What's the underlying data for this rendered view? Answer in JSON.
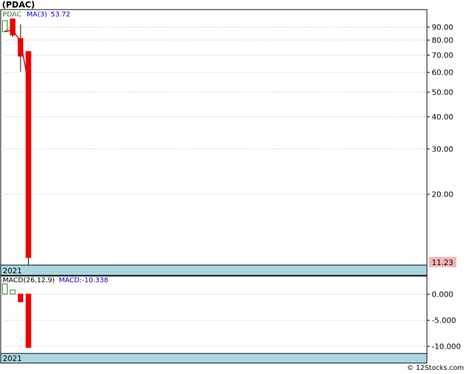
{
  "title": "(PDAC)",
  "footer": "© 12Stocks.com",
  "colors": {
    "up": "#ffffff",
    "up_border": "#2e7d32",
    "down": "#ee0000",
    "ma_line": "#dd0000",
    "ticker_text": "#2e7d32",
    "ma_text": "#0000cc",
    "year_band": "#a9d6e0",
    "last_price_bg": "#f4b6b6",
    "grid": "#bbbbbb"
  },
  "chart_data": [
    {
      "type": "candlestick",
      "ticker_label": "PDAC",
      "ma_label": "MA(3)",
      "ma_value": "53.72",
      "year_label": "2021",
      "last_price_label": "11.23",
      "scale": "log",
      "ylim": [
        10.5,
        105
      ],
      "y_ticks": [
        {
          "value": 90,
          "label": "90.00"
        },
        {
          "value": 80,
          "label": "80.00"
        },
        {
          "value": 70,
          "label": "70.00"
        },
        {
          "value": 60,
          "label": "60.00"
        },
        {
          "value": 50,
          "label": "50.00"
        },
        {
          "value": 40,
          "label": "40.00"
        },
        {
          "value": 30,
          "label": "30.00"
        },
        {
          "value": 20,
          "label": "20.00"
        }
      ],
      "candles": [
        {
          "open": 86.0,
          "close": 95.0,
          "high": 95.0,
          "low": 86.0
        },
        {
          "open": 96.5,
          "close": 83.5,
          "high": 96.5,
          "low": 82.0
        },
        {
          "open": 81.0,
          "close": 69.0,
          "high": 92.0,
          "low": 60.0
        },
        {
          "open": 72.0,
          "close": 11.23,
          "high": 72.0,
          "low": 10.5
        }
      ],
      "ma": [
        86.5,
        87.0,
        79.0,
        53.72
      ]
    },
    {
      "type": "bar",
      "label": "MACD(26,12,9)",
      "value_label": "MACD:-10.338",
      "year_label": "2021",
      "ylim": [
        -11.5,
        3.5
      ],
      "y_ticks": [
        {
          "value": 0,
          "label": "0.000"
        },
        {
          "value": -5,
          "label": "-5.000"
        },
        {
          "value": -10,
          "label": "-10.000"
        }
      ],
      "values": [
        2.0,
        0.8,
        -1.5,
        -10.338
      ]
    }
  ]
}
